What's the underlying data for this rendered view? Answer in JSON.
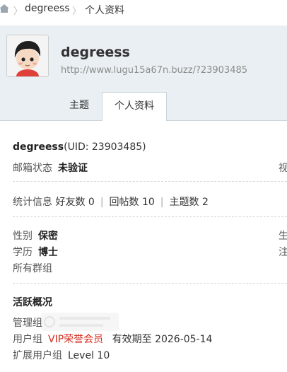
{
  "breadcrumb": {
    "items": [
      "degreess",
      "个人资料"
    ]
  },
  "profile": {
    "name": "degreess",
    "url": "http://www.lugu15a67n.buzz/?23903485"
  },
  "tabs": [
    {
      "label": "主题",
      "active": false
    },
    {
      "label": "个人资料",
      "active": true
    }
  ],
  "info": {
    "username": "degreess",
    "uid_text": "(UID: 23903485)",
    "email_status_label": "邮箱状态",
    "email_status_value": "未验证",
    "right_cut_1": "视",
    "stats_label": "统计信息",
    "friends": "好友数 0",
    "replies": "回帖数 10",
    "topics": "主题数 2",
    "gender_label": "性别",
    "gender_value": "保密",
    "right_cut_2": "生",
    "education_label": "学历",
    "education_value": "博士",
    "right_cut_3": "注",
    "groups_label": "所有群组"
  },
  "activity": {
    "title": "活跃概况",
    "admin_group_label": "管理组",
    "user_group_label": "用户组",
    "user_group_value": "VIP荣誉会员",
    "valid_until_label": "有效期至",
    "valid_until_value": "2026-05-14",
    "ext_group_label": "扩展用户组",
    "ext_group_value": "Level 10"
  },
  "colors": {
    "header_bg": "#e9eff2",
    "vip_red": "#d52b1e"
  }
}
